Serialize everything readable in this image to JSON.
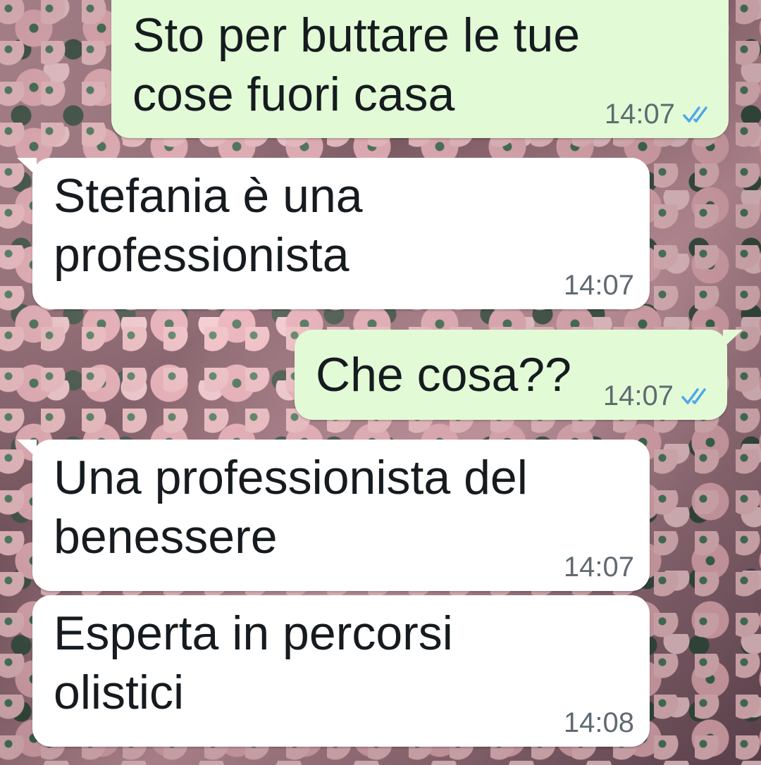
{
  "messages": [
    {
      "direction": "outgoing",
      "text": "Sto per buttare le tue\ncose fuori casa",
      "time": "14:07",
      "status_icon": "double-check-icon"
    },
    {
      "direction": "incoming",
      "text": "Stefania è una\nprofessionista",
      "time": "14:07"
    },
    {
      "direction": "outgoing",
      "text": "Che cosa??",
      "time": "14:07",
      "status_icon": "double-check-icon"
    },
    {
      "direction": "incoming",
      "text": "Una professionista del\nbenessere",
      "time": "14:07"
    },
    {
      "direction": "incoming",
      "text": "Esperta in percorsi\nolistici",
      "time": "14:08"
    }
  ],
  "colors": {
    "outgoing_bubble": "#e2fbd6",
    "incoming_bubble": "#ffffff",
    "read_tick": "#4fa6e8",
    "time_text": "#5f6b70"
  }
}
